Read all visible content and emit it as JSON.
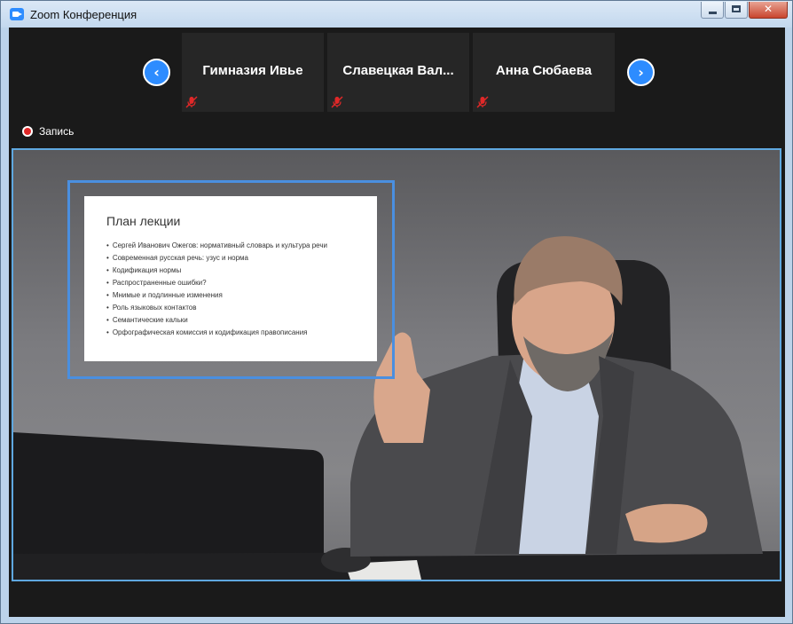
{
  "window": {
    "title": "Zoom Конференция",
    "controls": [
      "minimize-icon",
      "maximize-icon",
      "close-icon"
    ]
  },
  "participants": {
    "prev_icon": "‹",
    "next_icon": "›",
    "tiles": [
      {
        "name": "Гимназия Ивье",
        "mic": "muted"
      },
      {
        "name": "Славецкая  Вал...",
        "mic": "muted"
      },
      {
        "name": "Анна Сюбаева",
        "mic": "muted"
      }
    ]
  },
  "recording": {
    "label": "Запись"
  },
  "slide": {
    "title": "План лекции",
    "items": [
      "Сергей Иванович Ожегов: нормативный словарь и культура речи",
      "Современная русская речь: узус и норма",
      "Кодификация нормы",
      "Распространенные ошибки?",
      "Мнимые и подлинные изменения",
      "Роль языковых контактов",
      "Семантические кальки",
      "Орфографическая комиссия и кодификация правописания"
    ]
  },
  "colors": {
    "accent": "#2d8cff",
    "record": "#e02828",
    "background": "#1a1a1a",
    "tile": "#262626",
    "active_speaker_border": "#5fa8e0"
  }
}
